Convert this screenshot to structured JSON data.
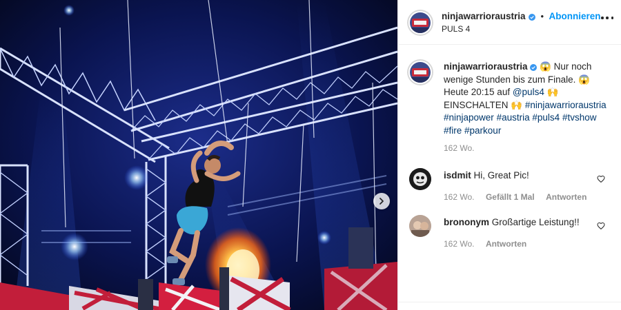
{
  "post": {
    "author": "ninjawarrioraustria",
    "follow_label": "Abonnieren",
    "location": "PULS 4",
    "caption": {
      "emoji_open": "😱",
      "line": "Nur noch wenige Stunden bis zum Finale.",
      "emoji_mid": "😱",
      "time_text": "Heute 20:15 auf",
      "mention": "@puls4",
      "emoji_hands": "🙌",
      "call": "EINSCHALTEN",
      "emoji_hands2": "🙌",
      "hashtags": [
        "#ninjawarrioraustria",
        "#ninjapower",
        "#austria",
        "#puls4",
        "#tvshow",
        "#fire",
        "#parkour"
      ]
    },
    "age": "162 Wo."
  },
  "comments": [
    {
      "user": "isdmit",
      "text": "Hi, Great Pic!",
      "age": "162 Wo.",
      "likes": "Gefällt 1 Mal",
      "reply": "Antworten"
    },
    {
      "user": "brononym",
      "text": "Großartige Leistung!!",
      "age": "162 Wo.",
      "reply": "Antworten"
    }
  ],
  "colors": {
    "accent": "#0095f6",
    "link": "#00376b",
    "muted": "#8e8e8e",
    "verified": "#3897f0"
  },
  "icons": [
    "verified-badge-icon",
    "more-options-icon",
    "heart-icon",
    "chevron-right-icon"
  ]
}
